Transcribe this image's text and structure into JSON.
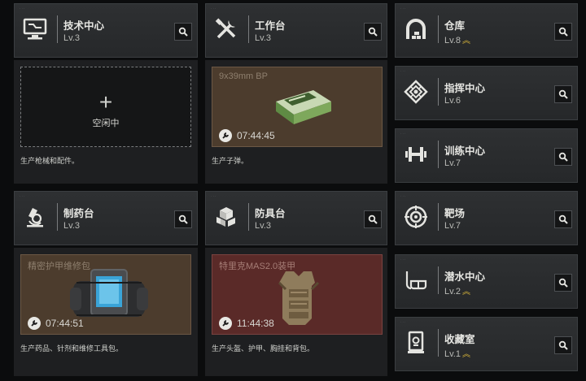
{
  "stations": {
    "tech": {
      "name": "技术中心",
      "level": "Lv.3",
      "icon": "monitor-icon"
    },
    "workbench": {
      "name": "工作台",
      "level": "Lv.3",
      "icon": "tools-icon"
    },
    "medstation": {
      "name": "制药台",
      "level": "Lv.3",
      "icon": "microscope-icon"
    },
    "armor": {
      "name": "防具台",
      "level": "Lv.3",
      "icon": "boxes-icon"
    },
    "storage": {
      "name": "仓库",
      "level": "Lv.8",
      "icon": "warehouse-icon",
      "upgradable": true
    },
    "command": {
      "name": "指挥中心",
      "level": "Lv.6",
      "icon": "emblem-icon"
    },
    "training": {
      "name": "训练中心",
      "level": "Lv.7",
      "icon": "dumbbell-icon"
    },
    "range": {
      "name": "靶场",
      "level": "Lv.7",
      "icon": "target-icon"
    },
    "dive": {
      "name": "潜水中心",
      "level": "Lv.2",
      "icon": "diving-mask-icon",
      "upgradable": true
    },
    "collection": {
      "name": "收藏室",
      "level": "Lv.1",
      "icon": "display-case-icon",
      "upgradable": true
    }
  },
  "production": {
    "tech": {
      "slot_label": "空闲中",
      "description": "生产枪械和配件。"
    },
    "workbench": {
      "item": "9x39mm BP",
      "timer": "07:44:45",
      "description": "生产子弹。"
    },
    "medstation": {
      "item": "精密护甲维修包",
      "timer": "07:44:51",
      "description": "生产药品、针剂和维修工具包。"
    },
    "armor": {
      "item": "特里克MAS2.0装甲",
      "timer": "11:44:38",
      "description": "生产头盔、护甲、胸挂和背包。"
    }
  },
  "upgrade_marker": "︽",
  "colors": {
    "upgrade": "#d8b53a",
    "panel": "#2a2c2e",
    "slot_brown": "#4c3c2d",
    "slot_maroon": "#5a2a28"
  }
}
